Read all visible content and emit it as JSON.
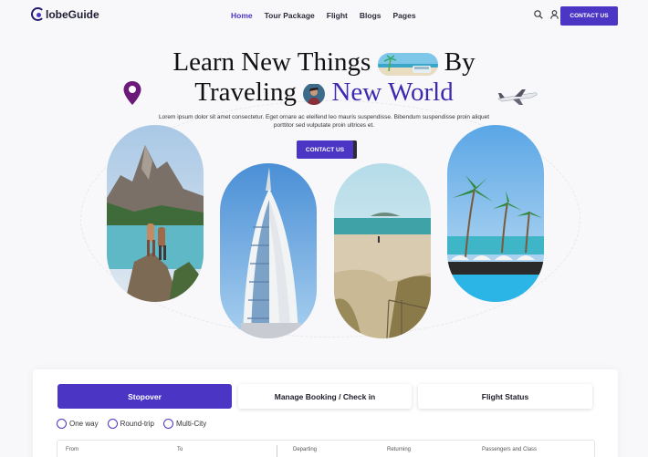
{
  "header": {
    "logo_text": "lobeGuide",
    "nav": [
      "Home",
      "Tour Package",
      "Flight",
      "Blogs",
      "Pages"
    ],
    "icons": [
      "search-icon",
      "user-icon"
    ],
    "cta": "CONTACT US"
  },
  "hero": {
    "line1_a": "Learn New Things",
    "line1_b": "By",
    "line2_a": "Traveling",
    "line2_b": "New World",
    "lede": "Lorem ipsum dolor sit amet consectetur. Eget ornare ac eleifend leo mauris suspendisse. Bibendum suspendisse proin aliquet porttitor sed vulputate proin ultrices et.",
    "cta": "CONTACT US"
  },
  "booking": {
    "tabs": [
      "Stopover",
      "Manage Booking / Check in",
      "Flight Status"
    ],
    "trip_types": [
      "One way",
      "Round-trip",
      "Multi-City"
    ],
    "fields": [
      "From",
      "To",
      "Departing",
      "Returning",
      "Passengers and Class"
    ]
  },
  "colors": {
    "accent": "#4b35c4",
    "heading": "#111111",
    "accent_text": "#3d2ab0"
  }
}
